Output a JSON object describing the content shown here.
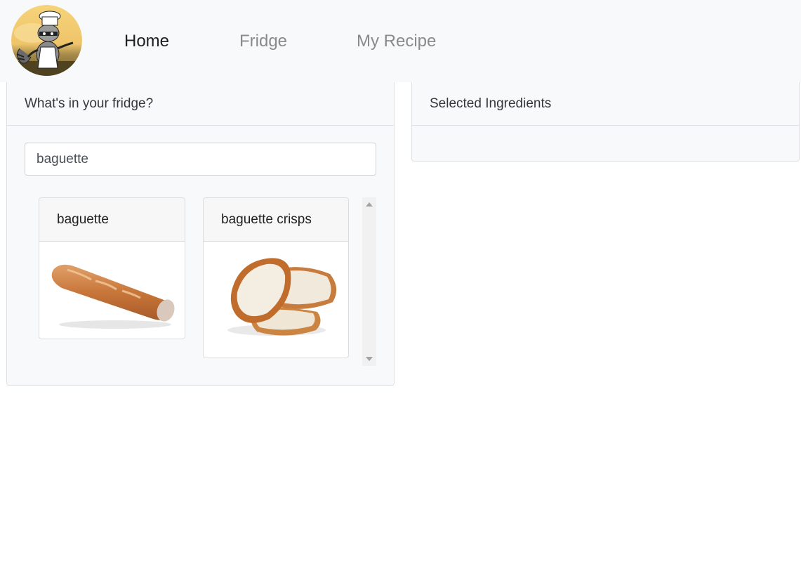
{
  "nav": {
    "logo_icon": "raccoon-chef-logo",
    "items": [
      {
        "label": "Home",
        "active": true
      },
      {
        "label": "Fridge",
        "active": false
      },
      {
        "label": "My Recipe",
        "active": false
      }
    ]
  },
  "fridge_panel": {
    "title": "What's in your fridge?",
    "search": {
      "value": "baguette",
      "placeholder": ""
    },
    "results": [
      {
        "name": "baguette",
        "image": "baguette-loaf-image"
      },
      {
        "name": "baguette crisps",
        "image": "baguette-slices-image"
      }
    ]
  },
  "selected_panel": {
    "title": "Selected Ingredients"
  }
}
